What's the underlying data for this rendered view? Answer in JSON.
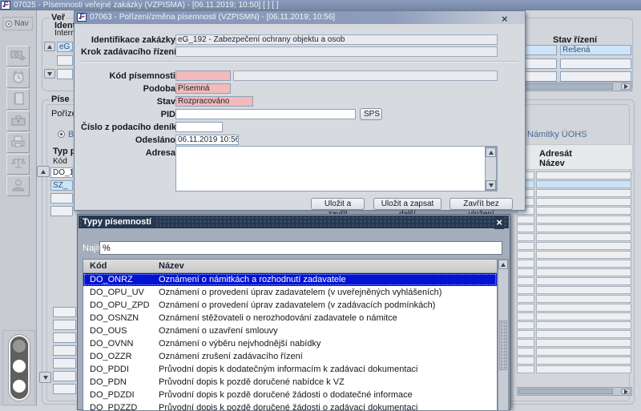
{
  "window": {
    "title": "07025 - Písemnosti veřejné zakázky (VZPISMA) - [06.11.2019; 10:50]  [ ]  [ ]",
    "logo_glyph": "F"
  },
  "sidebar": {
    "nav_label": "Nav",
    "icons": [
      "banknote-icon",
      "alarm-clock-icon",
      "notebook-icon",
      "toolbox-icon",
      "printer-icon",
      "scales-icon",
      "person-icon"
    ]
  },
  "background": {
    "zakazky": {
      "legend_fragment": "Veř",
      "ident_fragment": "Ident",
      "interni_fragment": "Interní",
      "value_fragment": "eG_1",
      "stav_rizeni_label": "Stav řízení",
      "stav_rizeni_value": "Řešená"
    },
    "pisemnosti": {
      "legend_fragment": "Píse",
      "tab_fragment": "Poříze",
      "radio_left_fragment": "B",
      "radio_right_label": "Námitky ÚOHS",
      "typ_fragment": "Typ p",
      "kod_label": "Kód",
      "cell_value_1": "DO_1",
      "cell_value_2": "SZ_",
      "adresat_label": "Adresát",
      "nazev_label": "Název"
    }
  },
  "dialog": {
    "title": "07063 - Pořízení/změna písemnosti (VZPISMN) - [06.11.2019; 10:56]",
    "logo_glyph": "F",
    "close_glyph": "×",
    "fields": {
      "identifikace": {
        "label": "Identifikace zakázky",
        "value": "eG_192 - Zabezpečení ochrany objektu a osob"
      },
      "krok": {
        "label": "Krok zadávacího řízení",
        "value": ""
      },
      "kod": {
        "label": "Kód písemnosti",
        "value": "",
        "value2": ""
      },
      "podoba": {
        "label": "Podoba",
        "value": "Písemná"
      },
      "stav": {
        "label": "Stav",
        "value": "Rozpracováno"
      },
      "pid": {
        "label": "PID",
        "value": "",
        "button": "SPS"
      },
      "cislo": {
        "label": "Číslo z podacího deníku",
        "value": ""
      },
      "odeslano": {
        "label": "Odesláno",
        "value": "06.11.2019 10:56"
      },
      "adresa": {
        "label": "Adresa",
        "value": ""
      }
    },
    "buttons": [
      "Uložit a zavřít",
      "Uložit a zapsat další",
      "Zavřít bez uložení"
    ]
  },
  "picker": {
    "title": "Typy písemností",
    "close_glyph": "×",
    "find_label": "Najít",
    "find_value": "%",
    "columns": {
      "kod": "Kód",
      "nazev": "Název"
    },
    "selected_index": 0,
    "rows": [
      {
        "kod": "DO_ONRZ",
        "nazev": "Oznámení o námitkách a rozhodnutí zadavatele"
      },
      {
        "kod": "DO_OPU_UV",
        "nazev": "Oznámení o provedení úprav zadavatelem (v uveřejněných vyhlášeních)"
      },
      {
        "kod": "DO_OPU_ZPD",
        "nazev": "Oznámení o provedení úprav zadavatelem (v zadávacích podmínkách)"
      },
      {
        "kod": "DO_OSNZN",
        "nazev": "Oznámení stěžovateli o nerozhodování zadavatele o námitce"
      },
      {
        "kod": "DO_OUS",
        "nazev": "Oznámení o uzavření smlouvy"
      },
      {
        "kod": "DO_OVNN",
        "nazev": "Oznámení o výběru nejvhodnější nabídky"
      },
      {
        "kod": "DO_OZZR",
        "nazev": "Oznámení zrušení zadávacího řízení"
      },
      {
        "kod": "DO_PDDI",
        "nazev": "Průvodní dopis k dodatečným informacím k zadávací dokumentaci"
      },
      {
        "kod": "DO_PDN",
        "nazev": "Průvodní dopis k pozdě doručené nabídce k VZ"
      },
      {
        "kod": "DO_PDZDI",
        "nazev": "Průvodní dopis k pozdě doručené žádosti o dodatečné informace"
      },
      {
        "kod": "DO_PDZZD",
        "nazev": "Průvodní dopis k pozdě doručené žádosti o zadávací dokumentaci"
      }
    ]
  },
  "colors": {
    "titlebar": "#7d8fb2",
    "picker_titlebar": "#26374f",
    "required_field_pink": "#f2baba",
    "highlight_blue": "#cde4f8",
    "selected_row_blue": "#0013d0"
  }
}
